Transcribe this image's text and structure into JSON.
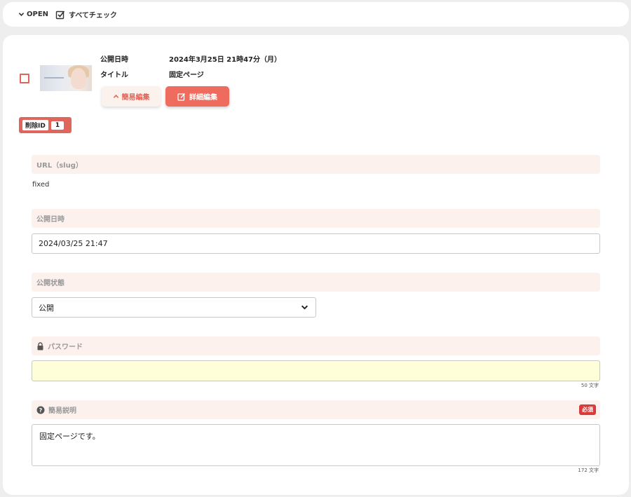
{
  "toolbar": {
    "open_label": "OPEN",
    "check_all_label": "すべてチェック"
  },
  "item": {
    "meta": {
      "publish_date_label": "公開日時",
      "publish_date_value": "2024年3月25日 21時47分（月）",
      "title_label": "タイトル",
      "title_value": "固定ページ"
    },
    "simple_edit_label": "簡易編集",
    "detail_edit_label": "詳細編集",
    "delete_id_label": "削除ID",
    "delete_id_value": "1"
  },
  "form": {
    "url": {
      "label": "URL（slug）",
      "value": "fixed"
    },
    "publish_date": {
      "label": "公開日時",
      "value": "2024/03/25 21:47"
    },
    "publish_status": {
      "label": "公開状態",
      "selected": "公開"
    },
    "password": {
      "label": "パスワード",
      "value": "",
      "counter": "50 文字"
    },
    "description": {
      "label": "簡易説明",
      "required_badge": "必須",
      "value": "固定ページです。",
      "counter": "172 文字"
    }
  },
  "colors": {
    "accent": "#ee6b5e",
    "section_bg": "#fdf1ee",
    "required": "#d93a3a",
    "password_bg": "#fefed8"
  }
}
